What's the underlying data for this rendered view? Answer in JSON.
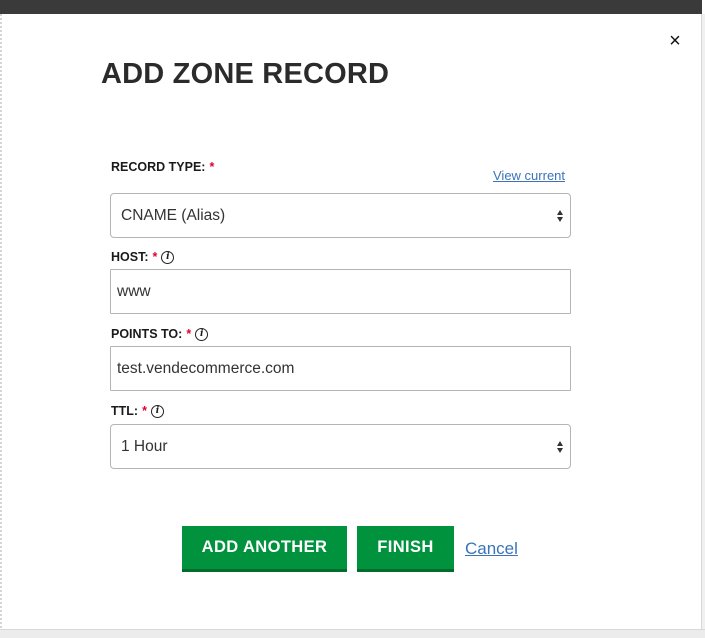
{
  "modal": {
    "title": "ADD ZONE RECORD",
    "close_glyph": "×",
    "required_marker": "*",
    "info_glyph": "i"
  },
  "record_type": {
    "label": "RECORD TYPE:",
    "view_current_link": "View current",
    "selected_value": "CNAME (Alias)"
  },
  "host": {
    "label": "HOST:",
    "value": "www"
  },
  "points_to": {
    "label": "POINTS TO:",
    "value": "test.vendecommerce.com"
  },
  "ttl": {
    "label": "TTL:",
    "selected_value": "1 Hour"
  },
  "actions": {
    "add_another_label": "ADD ANOTHER",
    "finish_label": "FINISH",
    "cancel_label": "Cancel"
  },
  "colors": {
    "primary_button": "#00923d",
    "link": "#3b73b9",
    "required": "#e4002b"
  }
}
